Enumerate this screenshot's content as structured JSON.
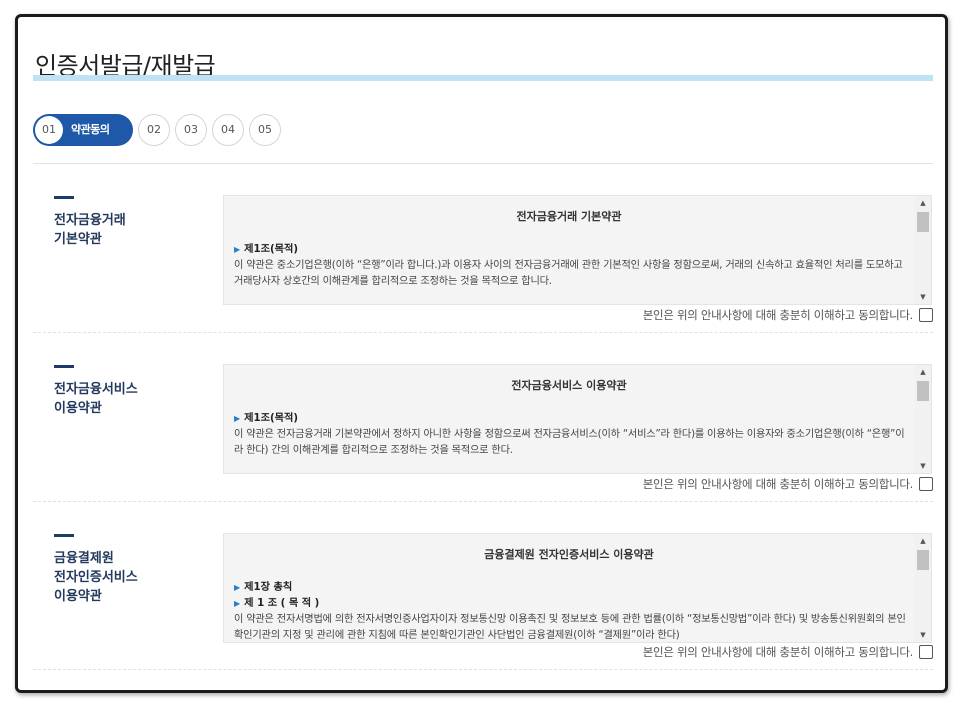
{
  "page_title": "인증서발급/재발급",
  "steps": {
    "active": {
      "num": "01",
      "label": "약관동의"
    },
    "others": [
      "02",
      "03",
      "04",
      "05"
    ]
  },
  "sections": [
    {
      "label_lines": [
        "전자금융거래",
        "기본약관"
      ],
      "box_title": "전자금융거래 기본약관",
      "heads": [
        "제1조(목적)"
      ],
      "text": "이 약관은 중소기업은행(이하 “은행”이라 합니다.)과 이용자 사이의 전자금융거래에 관한 기본적인 사항을 정함으로써, 거래의 신속하고 효율적인 처리를 도모하고 거래당사자 상호간의 이해관계를 합리적으로 조정하는 것을 목적으로 합니다.",
      "agree": "본인은 위의 안내사항에 대해 충분히 이해하고 동의합니다."
    },
    {
      "label_lines": [
        "전자금융서비스",
        "이용약관"
      ],
      "box_title": "전자금융서비스 이용약관",
      "heads": [
        "제1조(목적)"
      ],
      "text": "이 약관은 전자금융거래 기본약관에서 정하지 아니한 사항을 정함으로써 전자금융서비스(이하 “서비스”라 한다)를 이용하는 이용자와 중소기업은행(이하 “은행”이라 한다) 간의 이해관계를 합리적으로 조정하는 것을 목적으로 한다.",
      "agree": "본인은 위의 안내사항에 대해 충분히 이해하고 동의합니다."
    },
    {
      "label_lines": [
        "금융결제원",
        "전자인증서비스",
        "이용약관"
      ],
      "box_title": "금융결제원 전자인증서비스 이용약관",
      "heads": [
        "제1장 총칙",
        "제 1 조 ( 목 적 )"
      ],
      "text": "이 약관은 전자서명법에 의한 전자서명인증사업자이자 정보통신망 이용촉진 및 정보보호 등에 관한 법률(이하 “정보통신망법”이라 한다) 및 방송통신위원회의 본인확인기관의 지정 및 관리에 관한 지침에 따른 본인확인기관인 사단법인 금융결제원(이하 “결제원”이라 한다)",
      "agree": "본인은 위의 안내사항에 대해 충분히 이해하고 동의합니다."
    }
  ]
}
